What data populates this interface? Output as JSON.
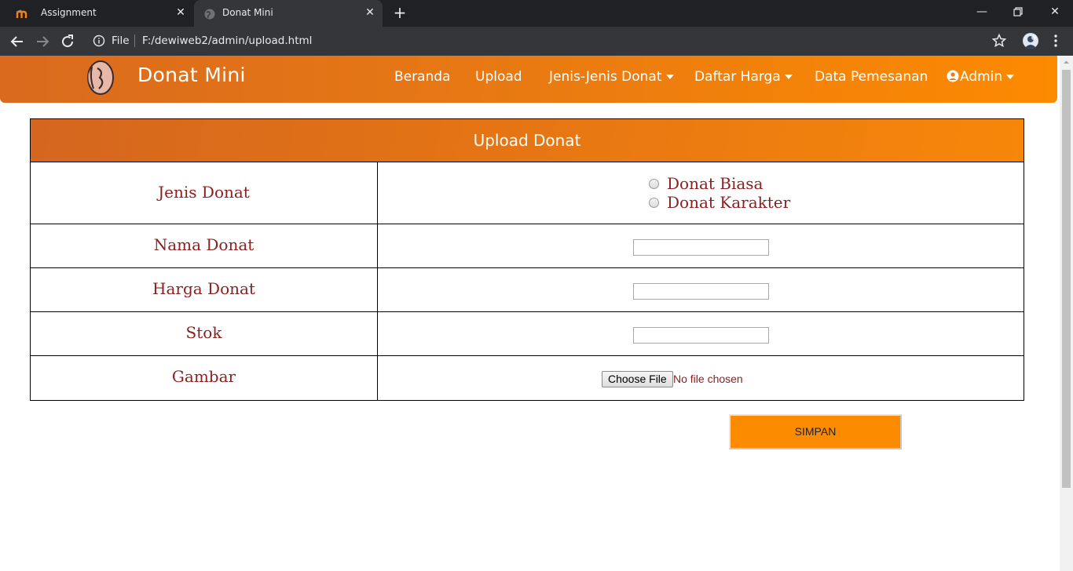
{
  "browser": {
    "tabs": [
      {
        "title": "Assignment",
        "active": false
      },
      {
        "title": "Donat Mini",
        "active": true
      }
    ],
    "address": {
      "scheme_label": "File",
      "url": "F:/dewiweb2/admin/upload.html"
    }
  },
  "navbar": {
    "brand": "Donat Mini",
    "items": [
      {
        "label": "Beranda",
        "dropdown": false
      },
      {
        "label": "Upload",
        "dropdown": false
      },
      {
        "label": "Jenis-Jenis Donat",
        "dropdown": true
      },
      {
        "label": "Daftar Harga",
        "dropdown": true
      },
      {
        "label": "Data Pemesanan",
        "dropdown": false
      },
      {
        "label": "Admin",
        "dropdown": true,
        "icon": "user-circle-icon"
      }
    ],
    "colors": {
      "gradient_start": "#d96a1e",
      "gradient_end": "#fd8a00",
      "text": "#ffffff"
    }
  },
  "form": {
    "title": "Upload Donat",
    "fields": {
      "jenis": {
        "label": "Jenis Donat",
        "options": [
          "Donat Biasa",
          "Donat Karakter"
        ],
        "selected": null
      },
      "nama": {
        "label": "Nama Donat",
        "value": ""
      },
      "harga": {
        "label": "Harga Donat",
        "value": ""
      },
      "stok": {
        "label": "Stok",
        "value": ""
      },
      "gambar": {
        "label": "Gambar",
        "button_label": "Choose File",
        "status": "No file chosen"
      }
    },
    "submit_label": "SIMPAN",
    "colors": {
      "label_text": "#8b2020",
      "submit_bg": "#fd8b00"
    }
  }
}
